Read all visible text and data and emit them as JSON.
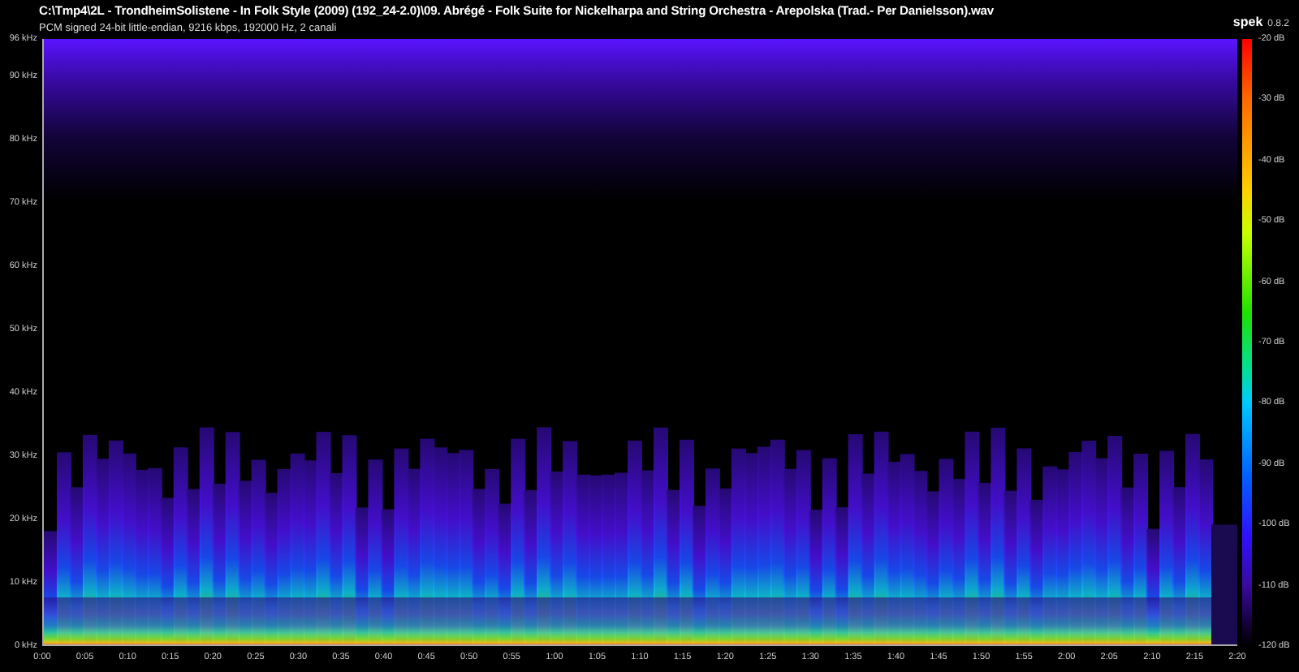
{
  "title": "C:\\Tmp4\\2L - TrondheimSolistene - In Folk Style (2009) (192_24-2.0)\\09. Abrégé - Folk Suite for Nickelharpa and String Orchestra - Arepolska (Trad.- Per Danielsson).wav",
  "subtitle": "PCM signed 24-bit little-endian, 9216 kbps, 192000 Hz, 2 canali",
  "app": {
    "name": "spek",
    "version": "0.8.2"
  },
  "y_axis_labels": [
    "96 kHz",
    "90 kHz",
    "80 kHz",
    "70 kHz",
    "60 kHz",
    "50 kHz",
    "40 kHz",
    "30 kHz",
    "20 kHz",
    "10 kHz",
    "0 kHz"
  ],
  "x_axis_labels": [
    "0:00",
    "0:05",
    "0:10",
    "0:15",
    "0:20",
    "0:25",
    "0:30",
    "0:35",
    "0:40",
    "0:45",
    "0:50",
    "0:55",
    "1:00",
    "1:05",
    "1:10",
    "1:15",
    "1:20",
    "1:25",
    "1:30",
    "1:35",
    "1:40",
    "1:45",
    "1:50",
    "1:55",
    "2:00",
    "2:05",
    "2:10",
    "2:15",
    "2:20"
  ],
  "legend_labels": [
    "-20 dB",
    "-30 dB",
    "-40 dB",
    "-50 dB",
    "-60 dB",
    "-70 dB",
    "-80 dB",
    "-90 dB",
    "-100 dB",
    "-110 dB",
    "-120 dB"
  ]
}
